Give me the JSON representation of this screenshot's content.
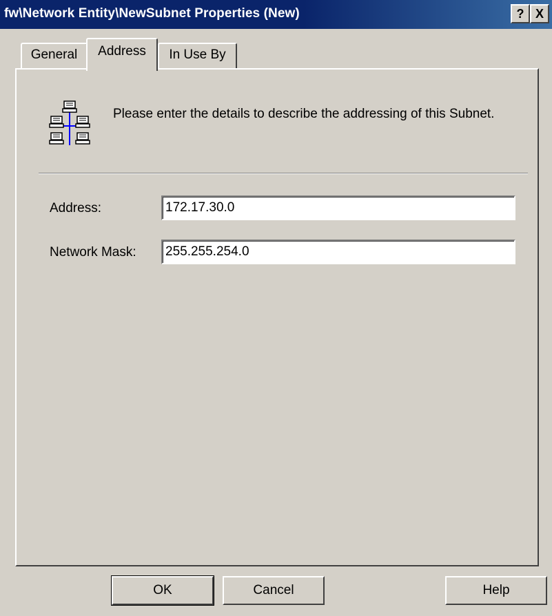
{
  "window": {
    "title": "fw\\Network Entity\\NewSubnet Properties (New)",
    "help_button": "?",
    "close_button": "X",
    "title_bar_color": "#0a246a",
    "face_color": "#d4d0c8"
  },
  "tabs": [
    {
      "label": "General",
      "selected": false
    },
    {
      "label": "Address",
      "selected": true
    },
    {
      "label": "In Use By",
      "selected": false
    }
  ],
  "panel": {
    "icon": "subnet-network-icon",
    "description": "Please enter the details to describe the addressing of this Subnet.",
    "fields": {
      "address": {
        "label": "Address:",
        "value": "172.17.30.0"
      },
      "network_mask": {
        "label": "Network Mask:",
        "value": "255.255.254.0"
      }
    }
  },
  "buttons": {
    "ok": "OK",
    "cancel": "Cancel",
    "help": "Help"
  }
}
